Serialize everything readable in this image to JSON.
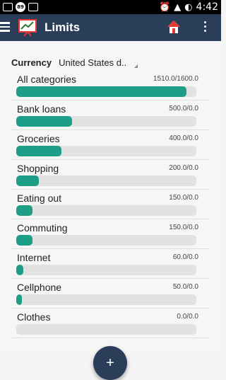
{
  "statusbar": {
    "badge_text": "89",
    "time": "4:42"
  },
  "appbar": {
    "title": "Limits",
    "menu_icon": "hamburger-menu-icon",
    "home_icon": "home-icon",
    "more_icon": "more-vert-icon"
  },
  "currency": {
    "label": "Currency",
    "selected": "United States d.."
  },
  "limits": [
    {
      "name": "All categories",
      "value_text": "1510.0/1600.0",
      "progress": 0.944
    },
    {
      "name": "Bank loans",
      "value_text": "500.0/0.0",
      "progress": 0.31
    },
    {
      "name": "Groceries",
      "value_text": "400.0/0.0",
      "progress": 0.25
    },
    {
      "name": "Shopping",
      "value_text": "200.0/0.0",
      "progress": 0.125
    },
    {
      "name": "Eating out",
      "value_text": "150.0/0.0",
      "progress": 0.09
    },
    {
      "name": "Commuting",
      "value_text": "150.0/0.0",
      "progress": 0.09
    },
    {
      "name": "Internet",
      "value_text": "60.0/0.0",
      "progress": 0.04
    },
    {
      "name": "Cellphone",
      "value_text": "50.0/0.0",
      "progress": 0.03
    },
    {
      "name": "Clothes",
      "value_text": "0.0/0.0",
      "progress": 0.0
    }
  ],
  "fab": {
    "label": "+"
  },
  "colors": {
    "appbar": "#2a3e5a",
    "progress_fill": "#1f9e87",
    "progress_track": "#e2e2e2"
  }
}
